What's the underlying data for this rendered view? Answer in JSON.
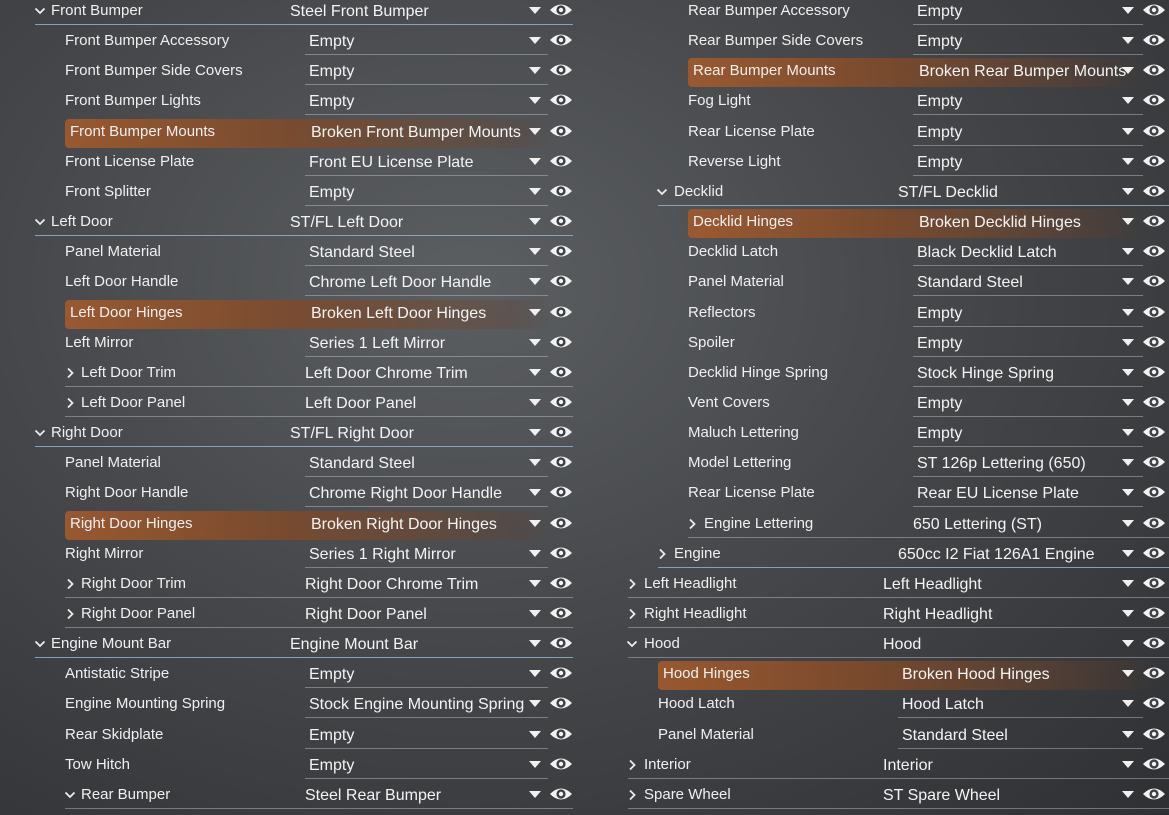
{
  "left_panel": [
    {
      "label": "Front Bumper",
      "value": "Steel Front Bumper",
      "type": "group",
      "expanded": true
    },
    {
      "label": "Front Bumper Accessory",
      "value": "Empty",
      "type": "child"
    },
    {
      "label": "Front Bumper Side Covers",
      "value": "Empty",
      "type": "child"
    },
    {
      "label": "Front Bumper Lights",
      "value": "Empty",
      "type": "child"
    },
    {
      "label": "Front Bumper Mounts",
      "value": "Broken Front Bumper Mounts",
      "type": "child",
      "highlight": true
    },
    {
      "label": "Front License Plate",
      "value": "Front EU License Plate",
      "type": "child"
    },
    {
      "label": "Front Splitter",
      "value": "Empty",
      "type": "child"
    },
    {
      "label": "Left Door",
      "value": "ST/FL Left Door",
      "type": "group",
      "expanded": true
    },
    {
      "label": "Panel Material",
      "value": "Standard Steel",
      "type": "child"
    },
    {
      "label": "Left Door Handle",
      "value": "Chrome Left Door Handle",
      "type": "child"
    },
    {
      "label": "Left Door Hinges",
      "value": "Broken Left Door Hinges",
      "type": "child",
      "highlight": true
    },
    {
      "label": "Left Mirror",
      "value": "Series 1 Left Mirror",
      "type": "child"
    },
    {
      "label": "Left Door Trim",
      "value": "Left Door Chrome Trim",
      "type": "subgroup",
      "expanded": false
    },
    {
      "label": "Left Door Panel",
      "value": "Left Door Panel",
      "type": "subgroup",
      "expanded": false
    },
    {
      "label": "Right Door",
      "value": "ST/FL Right Door",
      "type": "group",
      "expanded": true
    },
    {
      "label": "Panel Material",
      "value": "Standard Steel",
      "type": "child"
    },
    {
      "label": "Right Door Handle",
      "value": "Chrome Right Door Handle",
      "type": "child"
    },
    {
      "label": "Right Door Hinges",
      "value": "Broken Right Door Hinges",
      "type": "child",
      "highlight": true
    },
    {
      "label": "Right Mirror",
      "value": "Series 1 Right Mirror",
      "type": "child"
    },
    {
      "label": "Right Door Trim",
      "value": "Right Door Chrome Trim",
      "type": "subgroup",
      "expanded": false
    },
    {
      "label": "Right Door Panel",
      "value": "Right Door Panel",
      "type": "subgroup",
      "expanded": false
    },
    {
      "label": "Engine Mount Bar",
      "value": "Engine Mount Bar",
      "type": "group",
      "expanded": true
    },
    {
      "label": "Antistatic Stripe",
      "value": "Empty",
      "type": "child"
    },
    {
      "label": "Engine Mounting Spring",
      "value": "Stock Engine Mounting Spring",
      "type": "child"
    },
    {
      "label": "Rear Skidplate",
      "value": "Empty",
      "type": "child"
    },
    {
      "label": "Tow Hitch",
      "value": "Empty",
      "type": "child"
    },
    {
      "label": "Rear Bumper",
      "value": "Steel Rear Bumper",
      "type": "subgroup",
      "expanded": true
    }
  ],
  "right_panel": [
    {
      "label": "Rear Bumper Accessory",
      "value": "Empty",
      "type": "child"
    },
    {
      "label": "Rear Bumper Side Covers",
      "value": "Empty",
      "type": "child"
    },
    {
      "label": "Rear Bumper Mounts",
      "value": "Broken Rear Bumper Mounts",
      "type": "child",
      "highlight": true
    },
    {
      "label": "Fog Light",
      "value": "Empty",
      "type": "child"
    },
    {
      "label": "Rear License Plate",
      "value": "Empty",
      "type": "child"
    },
    {
      "label": "Reverse Light",
      "value": "Empty",
      "type": "child"
    },
    {
      "label": "Decklid",
      "value": "ST/FL Decklid",
      "type": "group",
      "expanded": true
    },
    {
      "label": "Decklid Hinges",
      "value": "Broken Decklid Hinges",
      "type": "child2",
      "highlight": true
    },
    {
      "label": "Decklid Latch",
      "value": "Black Decklid Latch",
      "type": "child2"
    },
    {
      "label": "Panel Material",
      "value": "Standard Steel",
      "type": "child2"
    },
    {
      "label": "Reflectors",
      "value": "Empty",
      "type": "child2"
    },
    {
      "label": "Spoiler",
      "value": "Empty",
      "type": "child2"
    },
    {
      "label": "Decklid Hinge Spring",
      "value": "Stock Hinge Spring",
      "type": "child2"
    },
    {
      "label": "Vent Covers",
      "value": "Empty",
      "type": "child2"
    },
    {
      "label": "Maluch Lettering",
      "value": "Empty",
      "type": "child2"
    },
    {
      "label": "Model Lettering",
      "value": "ST 126p Lettering (650)",
      "type": "child2"
    },
    {
      "label": "Rear License Plate",
      "value": "Rear EU License Plate",
      "type": "child2"
    },
    {
      "label": "Engine Lettering",
      "value": "650 Lettering (ST)",
      "type": "subgroup2",
      "expanded": false
    },
    {
      "label": "Engine",
      "value": "650cc I2 Fiat 126A1 Engine",
      "type": "group",
      "expanded": false
    },
    {
      "label": "Left Headlight",
      "value": "Left Headlight",
      "type": "top",
      "expanded": false
    },
    {
      "label": "Right Headlight",
      "value": "Right Headlight",
      "type": "top",
      "expanded": false
    },
    {
      "label": "Hood",
      "value": "Hood",
      "type": "top",
      "expanded": true
    },
    {
      "label": "Hood Hinges",
      "value": "Broken Hood Hinges",
      "type": "topchild",
      "highlight": true
    },
    {
      "label": "Hood Latch",
      "value": "Hood Latch",
      "type": "topchild"
    },
    {
      "label": "Panel Material",
      "value": "Standard Steel",
      "type": "topchild"
    },
    {
      "label": "Interior",
      "value": "Interior",
      "type": "top",
      "expanded": false
    },
    {
      "label": "Spare Wheel",
      "value": "ST Spare Wheel",
      "type": "top",
      "expanded": false
    }
  ],
  "icons": {
    "dropdown": "caret-down-icon",
    "visibility": "eye-icon",
    "expanded": "chevron-down-icon",
    "collapsed": "chevron-right-icon"
  },
  "colors": {
    "highlight": "#9a5a2e",
    "text": "#f0f0f0"
  }
}
